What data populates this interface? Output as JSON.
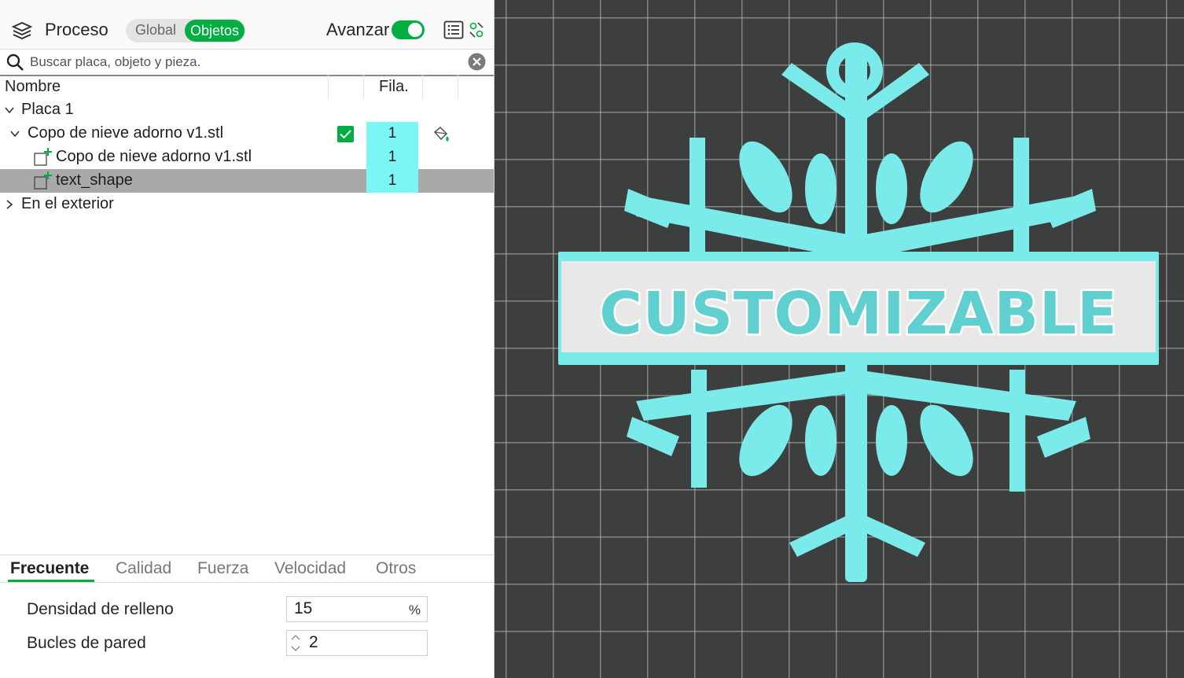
{
  "header": {
    "process_label": "Proceso",
    "segment": {
      "global": "Global",
      "objects": "Objetos"
    },
    "advance_label": "Avanzar",
    "advance_on": true
  },
  "search": {
    "placeholder": "Buscar placa, objeto y pieza."
  },
  "columns": {
    "name": "Nombre",
    "filament": "Fila."
  },
  "tree": {
    "plate": "Placa 1",
    "object": {
      "name": "Copo de nieve adorno v1.stl",
      "filament": "1",
      "checked": true
    },
    "parts": [
      {
        "name": "Copo de nieve adorno v1.stl",
        "filament": "1"
      },
      {
        "name": "text_shape",
        "filament": "1"
      }
    ],
    "outside": "En el exterior"
  },
  "tabs": [
    "Frecuente",
    "Calidad",
    "Fuerza",
    "Velocidad",
    "Otros"
  ],
  "active_tab": "Frecuente",
  "settings": {
    "infill": {
      "label": "Densidad de relleno",
      "value": "15",
      "unit": "%"
    },
    "walls": {
      "label": "Bucles de pared",
      "value": "2"
    }
  },
  "viewport": {
    "model_text": "CUSTOMIZABLE",
    "colors": {
      "model": "#7aeaea",
      "background": "#3d3e3e",
      "banner": "#e8e8e8",
      "accent": "#00ae42"
    }
  }
}
